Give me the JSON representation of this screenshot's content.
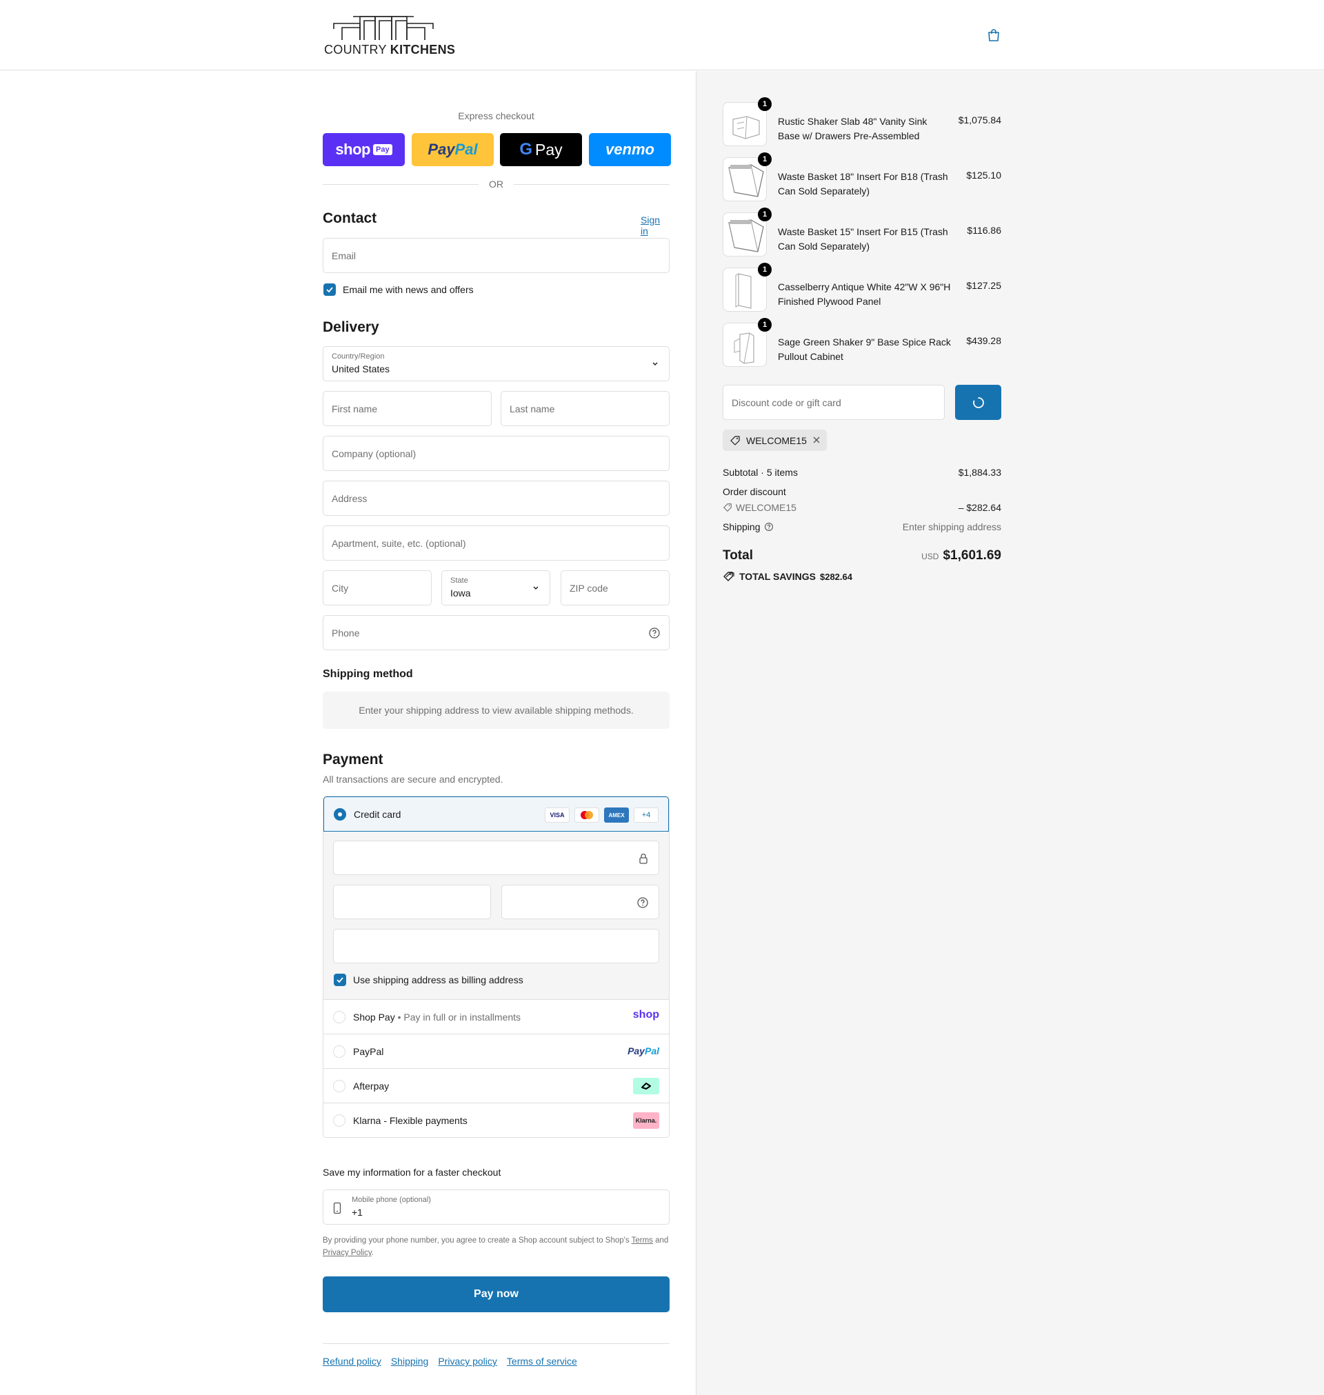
{
  "header": {
    "logo_word1": "COUNTRY",
    "logo_word2": "KITCHENS"
  },
  "express": {
    "title": "Express checkout",
    "shop_pay_word": "shop",
    "shop_pay_tag": "Pay",
    "paypal_word1": "Pay",
    "paypal_word2": "Pal",
    "gpay_g": "G",
    "gpay_word": "Pay",
    "venmo_word": "venmo",
    "or": "OR"
  },
  "contact": {
    "title": "Contact",
    "sign_in": "Sign in",
    "email_placeholder": "Email",
    "newsletter_label": "Email me with news and offers"
  },
  "delivery": {
    "title": "Delivery",
    "country_label": "Country/Region",
    "country_value": "United States",
    "first_name": "First name",
    "last_name": "Last name",
    "company": "Company (optional)",
    "address": "Address",
    "apartment": "Apartment, suite, etc. (optional)",
    "city": "City",
    "state_label": "State",
    "state_value": "Iowa",
    "zip": "ZIP code",
    "phone": "Phone"
  },
  "shipping_method": {
    "title": "Shipping method",
    "message": "Enter your shipping address to view available shipping methods."
  },
  "payment": {
    "title": "Payment",
    "subtitle": "All transactions are secure and encrypted.",
    "credit_card": "Credit card",
    "card_logos": [
      "VISA",
      "AMEX",
      "+4"
    ],
    "billing_same": "Use shipping address as billing address",
    "shop_pay": "Shop Pay",
    "shop_pay_sub": "Pay in full or in installments",
    "shop_badge": "shop",
    "paypal": "PayPal",
    "paypal_badge1": "Pay",
    "paypal_badge2": "Pal",
    "afterpay": "Afterpay",
    "klarna": "Klarna - Flexible payments",
    "klarna_badge": "Klarna."
  },
  "save_info": {
    "title": "Save my information for a faster checkout",
    "mobile_label": "Mobile phone (optional)",
    "mobile_value": "+1",
    "legal_text": "By providing your phone number, you agree to create a Shop account subject to Shop's",
    "terms": "Terms",
    "and": "and",
    "privacy": "Privacy Policy",
    "period": "."
  },
  "pay_now": "Pay now",
  "footer": [
    "Refund policy",
    "Shipping",
    "Privacy policy",
    "Terms of service"
  ],
  "cart": {
    "items": [
      {
        "qty": "1",
        "name": "Rustic Shaker Slab 48\" Vanity Sink Base w/ Drawers Pre-Assembled",
        "price": "$1,075.84"
      },
      {
        "qty": "1",
        "name": "Waste Basket 18\" Insert For B18 (Trash Can Sold Separately)",
        "price": "$125.10"
      },
      {
        "qty": "1",
        "name": "Waste Basket 15\" Insert For B15 (Trash Can Sold Separately)",
        "price": "$116.86"
      },
      {
        "qty": "1",
        "name": "Casselberry Antique White 42\"W X 96\"H Finished Plywood Panel",
        "price": "$127.25"
      },
      {
        "qty": "1",
        "name": "Sage Green Shaker 9\" Base Spice Rack Pullout Cabinet",
        "price": "$439.28"
      }
    ],
    "discount_placeholder": "Discount code or gift card",
    "applied_code": "WELCOME15",
    "subtotal_label": "Subtotal · 5 items",
    "subtotal_value": "$1,884.33",
    "order_discount_label": "Order discount",
    "discount_code": "WELCOME15",
    "discount_value": "– $282.64",
    "shipping_label": "Shipping",
    "shipping_value": "Enter shipping address",
    "total_label": "Total",
    "currency": "USD",
    "total_value": "$1,601.69",
    "savings_label": "TOTAL SAVINGS",
    "savings_value": "$282.64"
  },
  "colors": {
    "accent": "#1773b0",
    "shop_pay": "#5a31f4",
    "paypal": "#ffc439",
    "venmo": "#008cff"
  }
}
